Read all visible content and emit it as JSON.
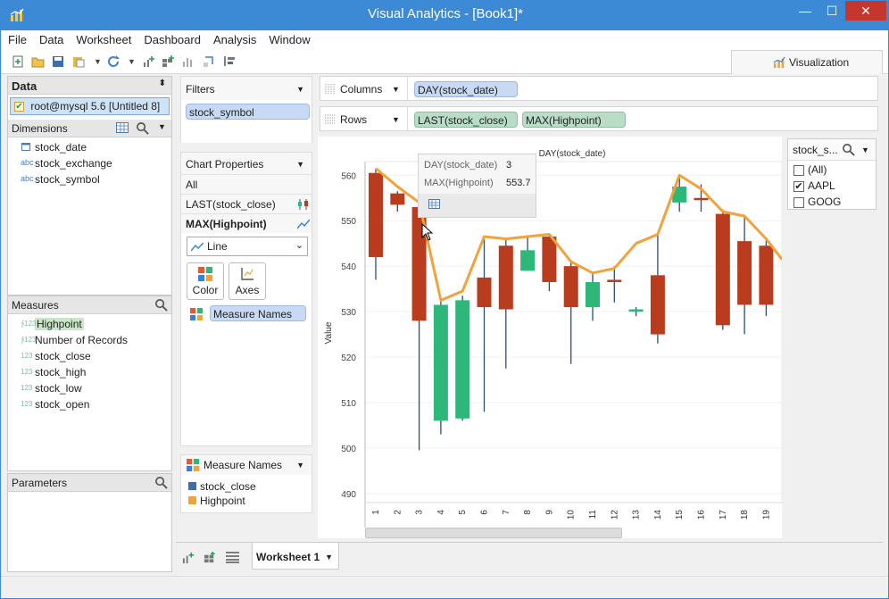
{
  "window": {
    "title": "Visual Analytics - [Book1]*",
    "min": "—",
    "max": "☐",
    "close": "✕"
  },
  "menu": [
    "File",
    "Data",
    "Worksheet",
    "Dashboard",
    "Analysis",
    "Window"
  ],
  "toolbar": {
    "visualization_label": "Visualization"
  },
  "data_panel": {
    "title": "Data",
    "connection": "root@mysql 5.6 [Untitled 8]",
    "dimensions_label": "Dimensions",
    "dimensions": [
      {
        "icon": "calendar-icon",
        "name": "stock_date"
      },
      {
        "icon": "abc",
        "name": "stock_exchange"
      },
      {
        "icon": "abc",
        "name": "stock_symbol"
      }
    ],
    "measures_label": "Measures",
    "measures": [
      {
        "icon": "123",
        "name": "Highpoint",
        "highlighted": true
      },
      {
        "icon": "123",
        "name": "Number of Records"
      },
      {
        "icon": "123",
        "name": "stock_close"
      },
      {
        "icon": "123",
        "name": "stock_high"
      },
      {
        "icon": "123",
        "name": "stock_low"
      },
      {
        "icon": "123",
        "name": "stock_open"
      }
    ],
    "parameters_label": "Parameters"
  },
  "filters": {
    "title": "Filters",
    "items": [
      "stock_symbol"
    ]
  },
  "chart_properties": {
    "title": "Chart Properties",
    "all_label": "All",
    "items": [
      {
        "name": "LAST(stock_close)",
        "bold": false
      },
      {
        "name": "MAX(Highpoint)",
        "bold": true
      }
    ],
    "mark_type": "Line",
    "color_label": "Color",
    "axes_label": "Axes",
    "measure_names_pill": "Measure Names"
  },
  "measure_legend": {
    "title": "Measure Names",
    "items": [
      {
        "name": "stock_close",
        "color": "#3f6ea6"
      },
      {
        "name": "Highpoint",
        "color": "#f2a23a"
      }
    ]
  },
  "shelves": {
    "columns_label": "Columns",
    "columns_pills": [
      "DAY(stock_date)"
    ],
    "rows_label": "Rows",
    "rows_pills": [
      "LAST(stock_close)",
      "MAX(Highpoint)"
    ]
  },
  "filter_card": {
    "title": "stock_s...",
    "items": [
      {
        "label": "(All)",
        "checked": false
      },
      {
        "label": "AAPL",
        "checked": true
      },
      {
        "label": "GOOG",
        "checked": false
      }
    ]
  },
  "tooltip": {
    "rows": [
      {
        "label": "DAY(stock_date)",
        "value": "3"
      },
      {
        "label": "MAX(Highpoint)",
        "value": "553.7"
      }
    ]
  },
  "sheet_tabs": [
    "Worksheet 1"
  ],
  "chart_data": {
    "type": "bar",
    "title": "DAY(stock_date)",
    "ylabel": "Value",
    "xlabel": "",
    "ylim": [
      488,
      563
    ],
    "yticks": [
      490,
      500,
      510,
      520,
      530,
      540,
      550,
      560
    ],
    "categories": [
      "1",
      "2",
      "3",
      "4",
      "5",
      "6",
      "7",
      "8",
      "9",
      "10",
      "11",
      "12",
      "13",
      "14",
      "15",
      "16",
      "17",
      "18",
      "19"
    ],
    "colors": {
      "up": "#2db87a",
      "down": "#b93c1e",
      "line": "#f2a23a"
    },
    "candles": [
      {
        "x": "1",
        "open": 560.5,
        "close": 542.0,
        "high": 561.5,
        "low": 537.0
      },
      {
        "x": "2",
        "open": 556.0,
        "close": 553.5,
        "high": 556.5,
        "low": 552.0
      },
      {
        "x": "3",
        "open": 553.0,
        "close": 528.0,
        "high": 555.0,
        "low": 499.5
      },
      {
        "x": "4",
        "open": 506.0,
        "close": 531.5,
        "high": 533.0,
        "low": 503.0
      },
      {
        "x": "5",
        "open": 506.5,
        "close": 532.5,
        "high": 533.5,
        "low": 506.0
      },
      {
        "x": "6",
        "open": 537.5,
        "close": 531.0,
        "high": 546.5,
        "low": 508.0
      },
      {
        "x": "7",
        "open": 544.5,
        "close": 530.5,
        "high": 546.0,
        "low": 517.5
      },
      {
        "x": "8",
        "open": 539.0,
        "close": 543.5,
        "high": 546.5,
        "low": 539.0
      },
      {
        "x": "9",
        "open": 546.5,
        "close": 536.5,
        "high": 547.0,
        "low": 534.5
      },
      {
        "x": "10",
        "open": 540.0,
        "close": 531.0,
        "high": 541.0,
        "low": 518.5
      },
      {
        "x": "11",
        "open": 531.0,
        "close": 536.5,
        "high": 538.5,
        "low": 528.0
      },
      {
        "x": "12",
        "open": 537.0,
        "close": 536.5,
        "high": 540.0,
        "low": 532.0
      },
      {
        "x": "13",
        "open": 530.0,
        "close": 530.5,
        "high": 531.0,
        "low": 529.0
      },
      {
        "x": "14",
        "open": 538.0,
        "close": 525.0,
        "high": 547.0,
        "low": 523.0
      },
      {
        "x": "15",
        "open": 554.0,
        "close": 557.5,
        "high": 560.0,
        "low": 552.0
      },
      {
        "x": "16",
        "open": 555.0,
        "close": 554.5,
        "high": 558.0,
        "low": 552.0
      },
      {
        "x": "17",
        "open": 551.5,
        "close": 527.0,
        "high": 552.5,
        "low": 526.0
      },
      {
        "x": "18",
        "open": 545.5,
        "close": 531.5,
        "high": 551.0,
        "low": 525.0
      },
      {
        "x": "19",
        "open": 544.5,
        "close": 531.5,
        "high": 546.0,
        "low": 529.0
      }
    ],
    "series": [
      {
        "name": "Highpoint",
        "values": [
          561.5,
          557.5,
          554.0,
          532.5,
          534.5,
          546.5,
          546.0,
          546.5,
          547.0,
          541.0,
          538.5,
          539.5,
          545.0,
          547.0,
          560.0,
          557.0,
          552.0,
          551.0,
          546.0
        ]
      }
    ]
  }
}
